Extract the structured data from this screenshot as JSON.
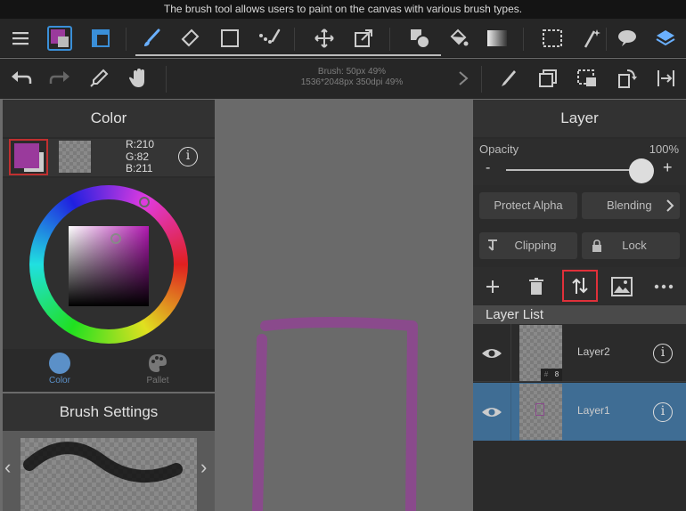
{
  "tooltip": "The brush tool allows users to paint on the canvas with various brush types.",
  "toolbar": {
    "icons": [
      "menu-icon",
      "color-swatch-icon",
      "layer-panel-icon",
      "brush-icon",
      "eraser-icon",
      "rectangle-icon",
      "dot-brush-icon",
      "move-icon",
      "transform-icon",
      "shape-icon",
      "fill-bucket-icon",
      "gradient-icon",
      "selection-icon",
      "magic-wand-icon",
      "speech-bubble-icon",
      "layers-icon"
    ]
  },
  "subtoolbar": {
    "brush_info_line1": "Brush: 50px 49%",
    "brush_info_line2": "1536*2048px 350dpi 49%"
  },
  "color_panel": {
    "title": "Color",
    "rgb": {
      "r": "R:210",
      "g": "G:82",
      "b": "B:211"
    },
    "info": "i",
    "foreground_color": "#9a3a9c",
    "tabs": [
      {
        "label": "Color",
        "active": true
      },
      {
        "label": "Pallet",
        "active": false
      }
    ]
  },
  "brush_settings": {
    "title": "Brush Settings",
    "prev": "‹",
    "next": "›"
  },
  "layer_panel": {
    "title": "Layer",
    "opacity_label": "Opacity",
    "opacity_value": "100%",
    "opacity_fraction": 1.0,
    "minus": "-",
    "plus": "+",
    "protect_alpha": "Protect Alpha",
    "blending": "Blending",
    "clipping": "Clipping",
    "lock": "Lock",
    "layer_list_label": "Layer List",
    "layers": [
      {
        "name": "Layer2",
        "badge_left": "#",
        "badge_right": "8",
        "info": "i",
        "selected": false
      },
      {
        "name": "Layer1",
        "info": "i",
        "selected": true
      }
    ]
  },
  "colors": {
    "accent": "#9a3a9c",
    "selected_layer": "#3f6d94",
    "highlight_box": "#e0303a"
  }
}
